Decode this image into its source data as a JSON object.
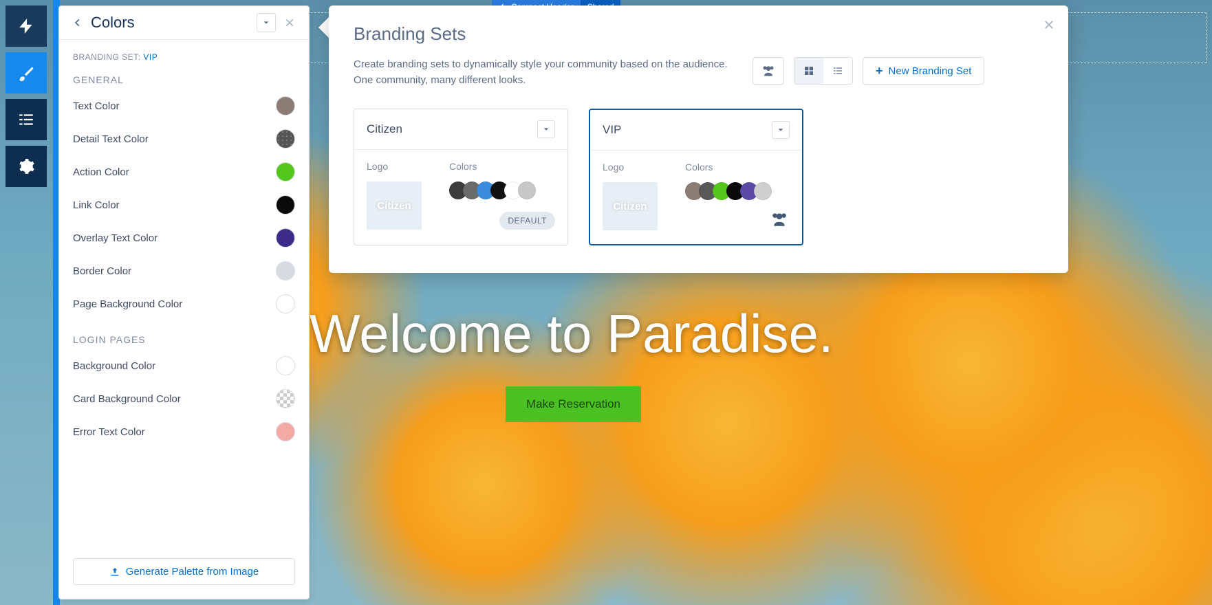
{
  "top_component": {
    "name": "Compact Header",
    "badge": "Shared"
  },
  "left_nav": {
    "items": [
      "lightning",
      "brush",
      "list",
      "gear"
    ],
    "active": 1
  },
  "colors_panel": {
    "title": "Colors",
    "branding_set_prefix": "BRANDING SET: ",
    "branding_set_name": "VIP",
    "sections": {
      "general": {
        "label": "GENERAL",
        "rows": [
          {
            "label": "Text Color",
            "color": "#8b7d73"
          },
          {
            "label": "Detail Text Color",
            "color": "checker-dark"
          },
          {
            "label": "Action Color",
            "color": "#55c61b"
          },
          {
            "label": "Link Color",
            "color": "#0a0a0a"
          },
          {
            "label": "Overlay Text Color",
            "color": "#3d2b8a"
          },
          {
            "label": "Border Color",
            "color": "#d7dbe0"
          },
          {
            "label": "Page Background Color",
            "color": "#ffffff"
          }
        ]
      },
      "login": {
        "label": "LOGIN PAGES",
        "rows": [
          {
            "label": "Background Color",
            "color": "#ffffff"
          },
          {
            "label": "Card Background Color",
            "color": "checker"
          },
          {
            "label": "Error Text Color",
            "color": "#f3a9a4"
          }
        ]
      }
    },
    "generate_label": "Generate Palette from Image"
  },
  "branding_modal": {
    "title": "Branding Sets",
    "description": "Create branding sets to dynamically style your community based on the audience. One community, many different looks.",
    "new_label": "New Branding Set",
    "view_mode": "grid",
    "cards": [
      {
        "name": "Citizen",
        "logo_text": "Citizen",
        "logo_label": "Logo",
        "colors_label": "Colors",
        "swatches": [
          "#3c3c3c",
          "#6b6b6b",
          "#3a8dde",
          "#111111",
          "#ffffff",
          "#c8c8c8"
        ],
        "default_label": "DEFAULT",
        "is_default": true,
        "selected": false
      },
      {
        "name": "VIP",
        "logo_text": "Citizen",
        "logo_label": "Logo",
        "colors_label": "Colors",
        "swatches": [
          "#8b7d73",
          "#585858",
          "#55c61b",
          "#0a0a0a",
          "#5a4aa6",
          "#cfcfcf"
        ],
        "is_default": false,
        "selected": true
      }
    ]
  },
  "hero": {
    "title": "Welcome to Paradise.",
    "cta": "Make Reservation"
  }
}
